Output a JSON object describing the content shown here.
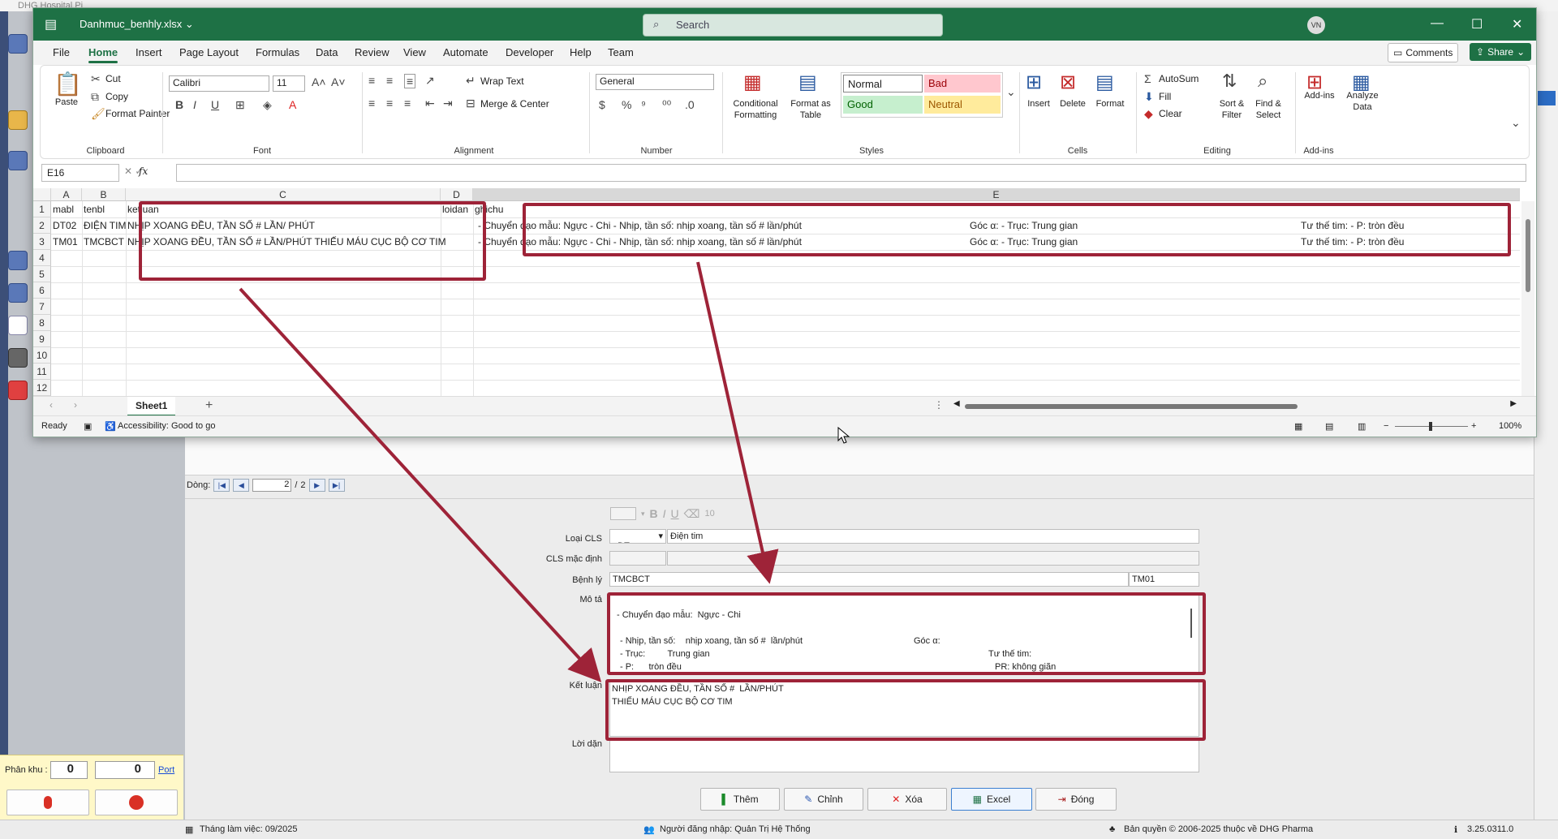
{
  "colors": {
    "excel_green": "#1e7145",
    "highlight_red": "#9e2338",
    "bad_fill": "#ffc7ce",
    "good_fill": "#c6efce",
    "neutral_fill": "#ffeb9c"
  },
  "background_app": {
    "title_fragment": "DHG Hospital Pi"
  },
  "excel": {
    "filename": "Danhmuc_benhly.xlsx",
    "search_placeholder": "Search",
    "avatar": "VN",
    "menu": [
      "File",
      "Home",
      "Insert",
      "Page Layout",
      "Formulas",
      "Data",
      "Review",
      "View",
      "Automate",
      "Developer",
      "Help",
      "Team"
    ],
    "comments_label": "Comments",
    "share_label": "Share",
    "ribbon": {
      "clipboard": {
        "paste": "Paste",
        "cut": "Cut",
        "copy": "Copy",
        "format_painter": "Format Painter",
        "label": "Clipboard"
      },
      "font": {
        "name": "Calibri",
        "size": "11",
        "label": "Font",
        "bold": "B",
        "italic": "I",
        "underline": "U"
      },
      "alignment": {
        "wrap_text": "Wrap Text",
        "merge_center": "Merge & Center",
        "label": "Alignment"
      },
      "number": {
        "format": "General",
        "label": "Number"
      },
      "styles": {
        "conditional": "Conditional Formatting",
        "format_table": "Format as Table",
        "normal": "Normal",
        "bad": "Bad",
        "good": "Good",
        "neutral": "Neutral",
        "label": "Styles"
      },
      "cells": {
        "insert": "Insert",
        "delete": "Delete",
        "format": "Format",
        "label": "Cells"
      },
      "editing": {
        "autosum": "AutoSum",
        "fill": "Fill",
        "clear": "Clear",
        "sort_filter": "Sort & Filter",
        "find_select": "Find & Select",
        "label": "Editing"
      },
      "addins": {
        "addins": "Add-ins",
        "analyze": "Analyze Data",
        "label": "Add-ins"
      }
    },
    "name_box": "E16",
    "columns": [
      "A",
      "B",
      "C",
      "D",
      "E"
    ],
    "rows": [
      {
        "n": "1",
        "a": "mabl",
        "b": "tenbl",
        "c": "ketluan",
        "d": "loidan",
        "e": "ghichu"
      },
      {
        "n": "2",
        "a": "DT02",
        "b": "ĐIỆN TIM",
        "c": "NHỊP XOANG ĐỀU, TẦN SỐ # LẦN/ PHÚT",
        "d": "",
        "e1": "- Chuyển đạo mẫu:  Ngực - Chi   - Nhịp, tần số:  nhịp xoang, tần số #  lần/phút",
        "e2": "Góc α:  - Trục:      Trung gian",
        "e3": "Tư thế tim:  - P:    tròn đều"
      },
      {
        "n": "3",
        "a": "TM01",
        "b": "TMCBCT",
        "c": "NHỊP XOANG ĐỀU, TẦN SỐ #  LẦN/PHÚT THIẾU MÁU CỤC BỘ CƠ TIM",
        "d": "",
        "e1": "- Chuyển đạo mẫu:  Ngực - Chi   - Nhịp, tần số:  nhịp xoang, tần số #  lần/phút",
        "e2": "Góc α:  - Trục:      Trung gian",
        "e3": "Tư thế tim:  - P:    tròn đều"
      }
    ],
    "empty_rows": [
      "4",
      "5",
      "6",
      "7",
      "8",
      "9",
      "10",
      "11",
      "12"
    ],
    "sheet_tab": "Sheet1",
    "status_ready": "Ready",
    "accessibility": "Accessibility: Good to go",
    "zoom": "100%"
  },
  "form": {
    "nav_label": "Dòng:",
    "nav_page": "2",
    "nav_total": "2",
    "loai_cls_label": "Loại CLS",
    "loai_cls_code": "DT",
    "loai_cls_name": "Điện tim",
    "cls_mac_dinh_label": "CLS mặc định",
    "benh_ly_label": "Bệnh lý",
    "benh_ly_name": "TMCBCT",
    "benh_ly_code": "TM01",
    "mo_ta_label": "Mô tả",
    "mo_ta_line1": "- Chuyển đạo mẫu:  Ngực - Chi",
    "mo_ta_line2a": "- Nhịp, tần số:    nhịp xoang, tần số #  lần/phút",
    "mo_ta_line2b": "Góc α:",
    "mo_ta_line3a": "- Trục:         Trung gian",
    "mo_ta_line3b": "Tư thế tim:",
    "mo_ta_line4a": "- P:      tròn đều",
    "mo_ta_line4b": "PR: không giãn",
    "ket_luan_label": "Kết luận",
    "ket_luan_line1": "NHỊP XOANG ĐỀU, TẦN SỐ #  LẦN/PHÚT",
    "ket_luan_line2": "THIẾU MÁU CỤC BỘ CƠ TIM",
    "loi_dan_label": "Lời dặn",
    "font_size": "10"
  },
  "buttons": {
    "them": "Thêm",
    "chinh": "Chỉnh",
    "xoa": "Xóa",
    "excel": "Excel",
    "dong": "Đóng"
  },
  "left_panel": {
    "phan_khu_label": "Phân khu :",
    "phan_khu_value": "0",
    "second_value": "0",
    "port_label": "Port"
  },
  "status": {
    "month": "Tháng làm việc: 09/2025",
    "user": "Người đăng nhập: Quản Trị Hệ Thống",
    "copyright": "Bản quyền © 2006-2025 thuộc về DHG Pharma",
    "version": "3.25.0311.0"
  }
}
